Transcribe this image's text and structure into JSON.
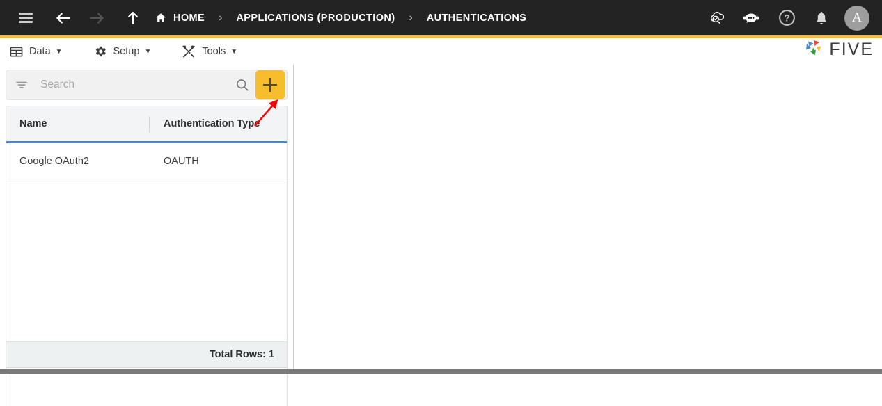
{
  "topbar": {
    "menu_toggle": "hamburger-menu",
    "back_label": "back-arrow",
    "forward_label": "forward-arrow",
    "up_label": "up-arrow",
    "breadcrumbs": [
      {
        "label": "HOME",
        "icon": "home-icon"
      },
      {
        "label": "APPLICATIONS (PRODUCTION)",
        "icon": ""
      },
      {
        "label": "AUTHENTICATIONS",
        "icon": ""
      }
    ],
    "separator": "›",
    "actions": [
      {
        "name": "cloud-search-icon"
      },
      {
        "name": "chat-bot-icon"
      },
      {
        "name": "help-icon"
      },
      {
        "name": "notifications-bell-icon"
      }
    ],
    "avatar_initial": "A",
    "bg_color": "#232323",
    "accent_color": "#f5be2a"
  },
  "menubar": {
    "items": [
      {
        "label": "Data",
        "icon": "table-grid-icon",
        "caret": "▼"
      },
      {
        "label": "Setup",
        "icon": "gear-icon",
        "caret": "▼"
      },
      {
        "label": "Tools",
        "icon": "tools-icon",
        "caret": "▼"
      }
    ],
    "logo_text": "FIVE"
  },
  "search": {
    "placeholder": "Search",
    "value": "",
    "filter_icon": "filter-icon",
    "search_icon": "magnifier-icon",
    "add_button_label": "+",
    "add_button_color": "#f6be2c"
  },
  "table": {
    "columns": [
      "Name",
      "Authentication Type"
    ],
    "rows": [
      {
        "name": "Google OAuth2",
        "type": "OAUTH"
      }
    ],
    "header_underline_color": "#4a87cd",
    "footer_label": "Total Rows: 1"
  },
  "annotation": {
    "type": "arrow",
    "color": "#ff0000",
    "points_to": "add-button"
  }
}
